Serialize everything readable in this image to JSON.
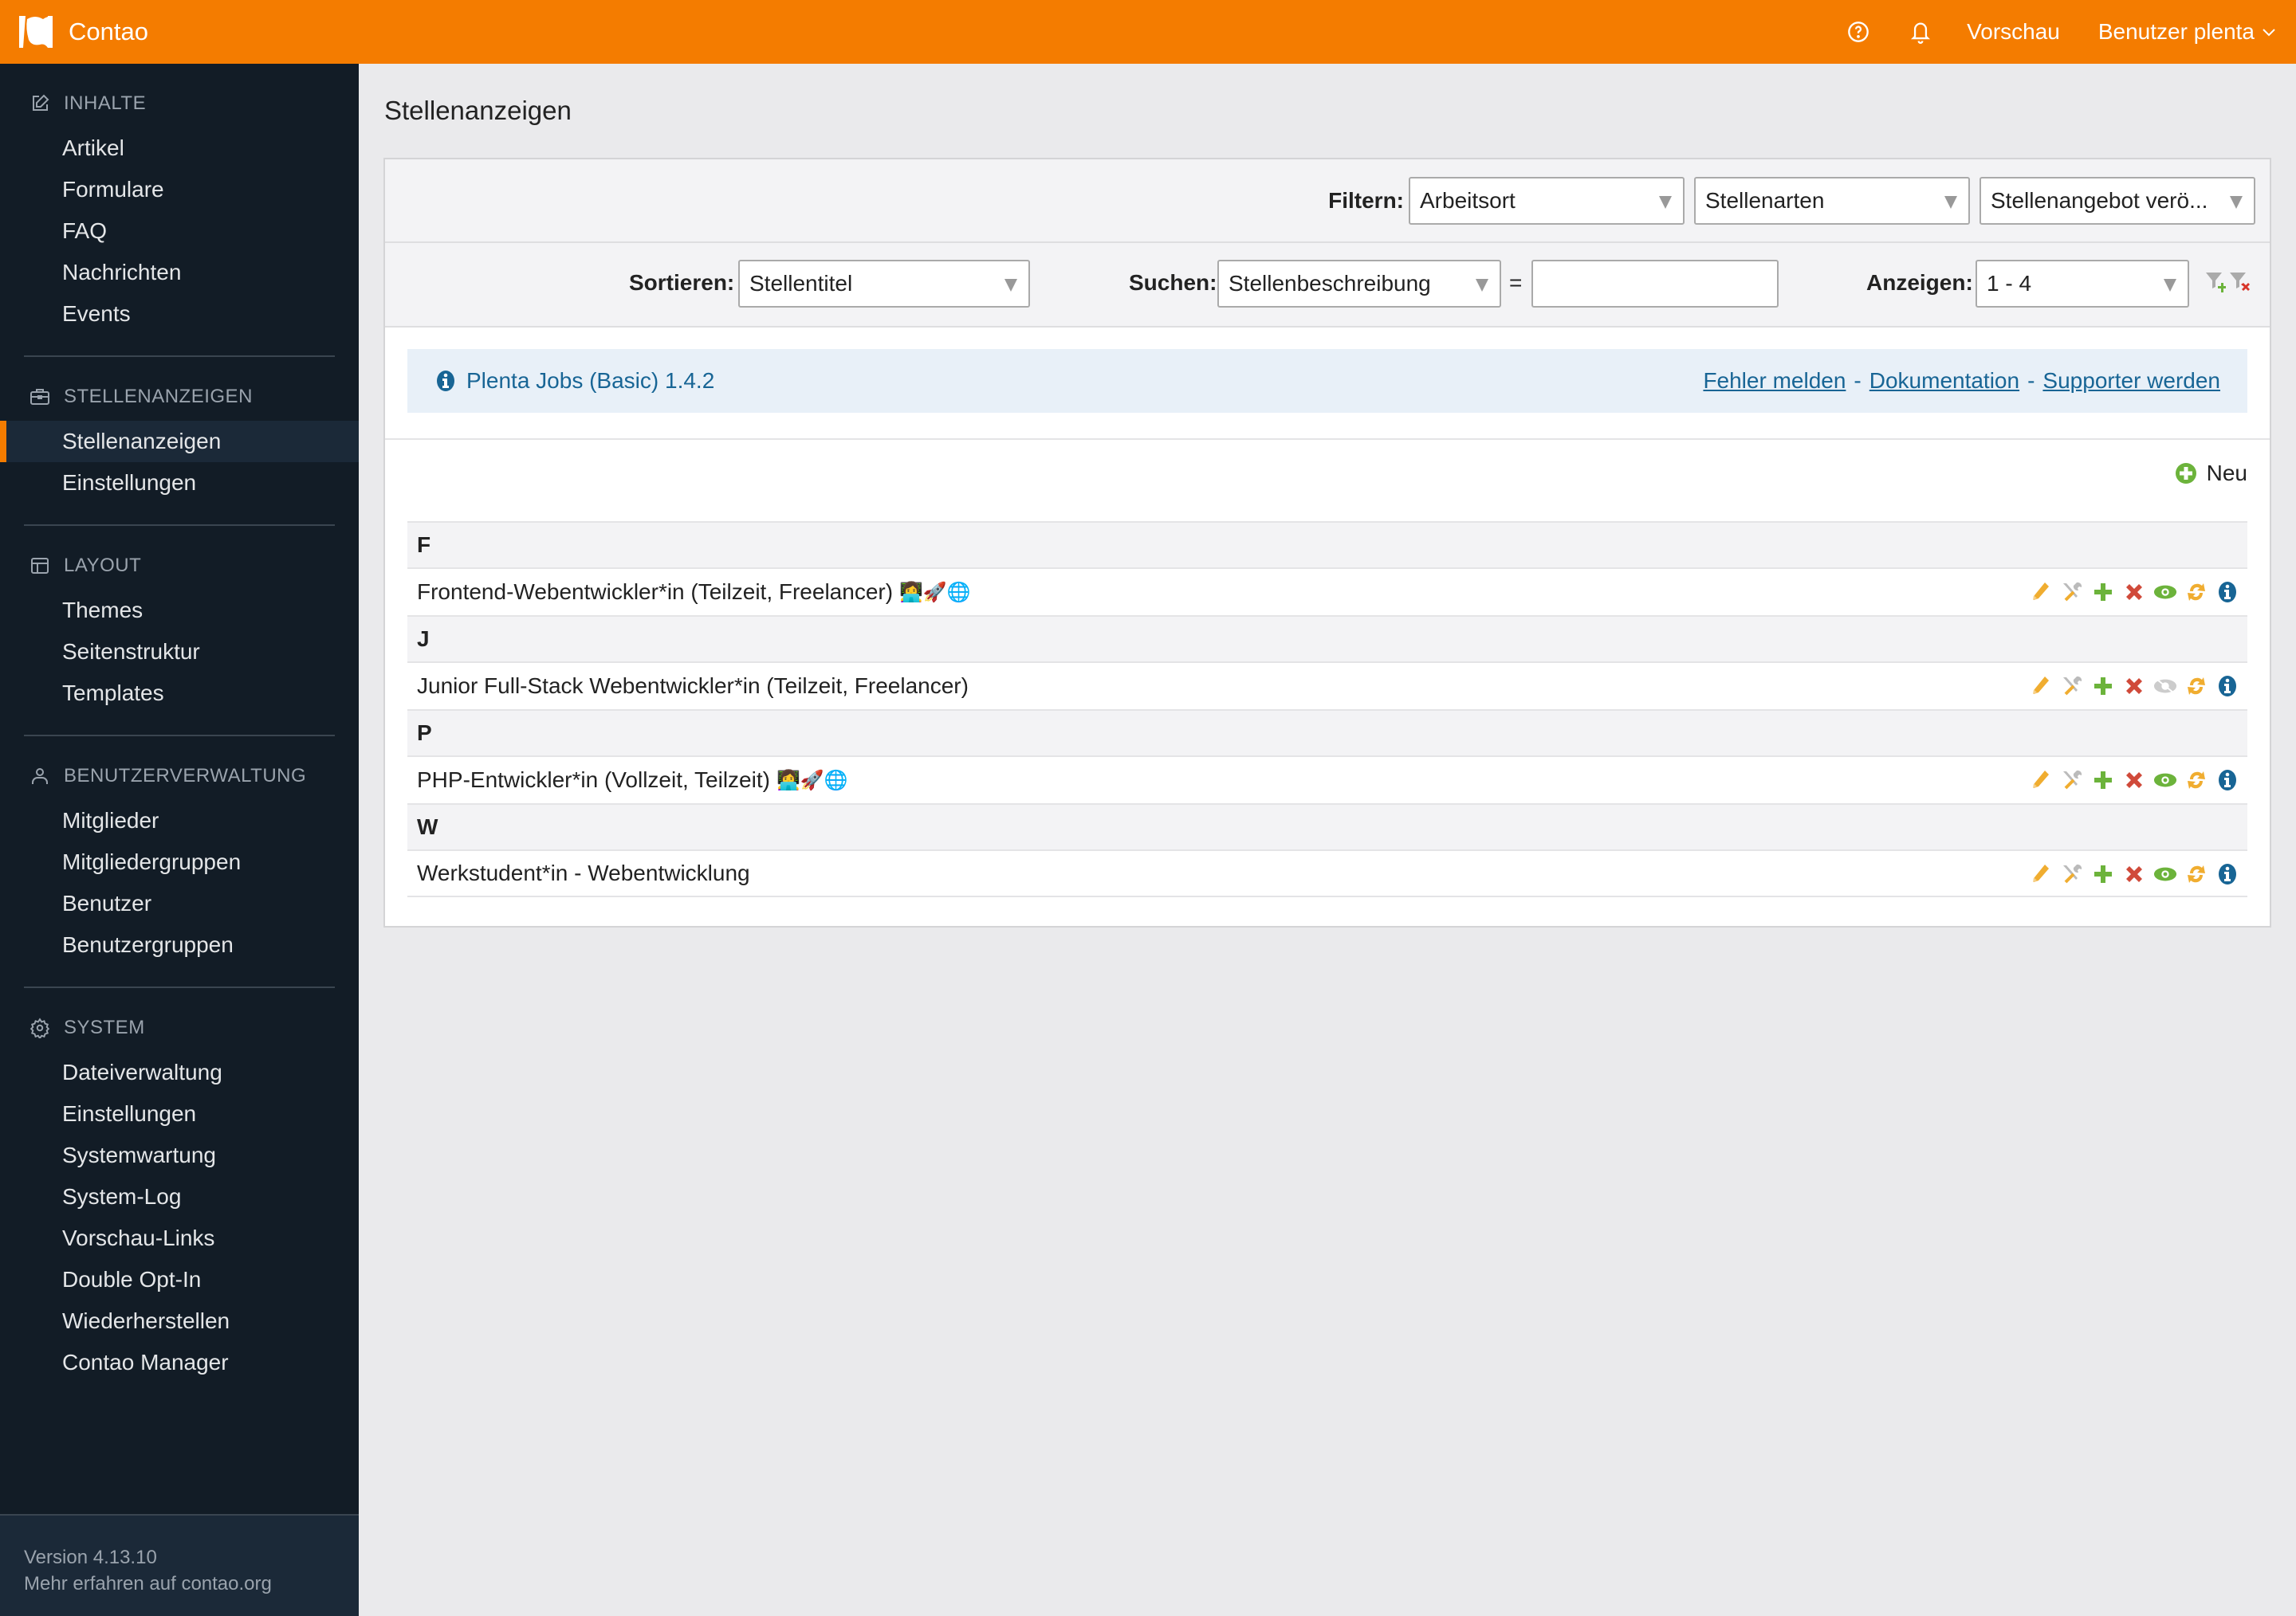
{
  "header": {
    "app_name": "Contao",
    "help_icon": "help-circle-icon",
    "notifications_icon": "bell-icon",
    "preview_label": "Vorschau",
    "user_label": "Benutzer plenta",
    "brand_color": "#f47c00"
  },
  "sidebar": {
    "groups": [
      {
        "label": "INHALTE",
        "icon": "edit-icon",
        "items": [
          "Artikel",
          "Formulare",
          "FAQ",
          "Nachrichten",
          "Events"
        ]
      },
      {
        "label": "STELLENANZEIGEN",
        "icon": "briefcase-icon",
        "items": [
          "Stellenanzeigen",
          "Einstellungen"
        ],
        "active": "Stellenanzeigen"
      },
      {
        "label": "LAYOUT",
        "icon": "layout-icon",
        "items": [
          "Themes",
          "Seitenstruktur",
          "Templates"
        ]
      },
      {
        "label": "BENUTZERVERWALTUNG",
        "icon": "user-icon",
        "items": [
          "Mitglieder",
          "Mitgliedergruppen",
          "Benutzer",
          "Benutzergruppen"
        ]
      },
      {
        "label": "SYSTEM",
        "icon": "gear-icon",
        "items": [
          "Dateiverwaltung",
          "Einstellungen",
          "Systemwartung",
          "System-Log",
          "Vorschau-Links",
          "Double Opt-In",
          "Wiederherstellen",
          "Contao Manager"
        ]
      }
    ],
    "footer": {
      "version": "Version 4.13.10",
      "learn_more": "Mehr erfahren auf contao.org"
    }
  },
  "main": {
    "page_title": "Stellenanzeigen",
    "filter": {
      "label": "Filtern:",
      "selects": [
        "Arbeitsort",
        "Stellenarten",
        "Stellenangebot verö..."
      ]
    },
    "sort": {
      "label": "Sortieren:",
      "value": "Stellentitel"
    },
    "search": {
      "label": "Suchen:",
      "field": "Stellenbeschreibung",
      "equals": "=",
      "value": ""
    },
    "limit": {
      "label": "Anzeigen:",
      "value": "1 - 4"
    },
    "info": {
      "title": "Plenta Jobs (Basic) 1.4.2",
      "links": [
        "Fehler melden",
        "Dokumentation",
        "Supporter werden"
      ],
      "separator": "-"
    },
    "new_label": "Neu",
    "groups": [
      {
        "letter": "F",
        "rows": [
          {
            "title": "Frontend-Webentwickler*in (Teilzeit, Freelancer)",
            "emoji": "👩‍💻🚀🌐",
            "published": true
          }
        ]
      },
      {
        "letter": "J",
        "rows": [
          {
            "title": "Junior Full-Stack Webentwickler*in (Teilzeit, Freelancer)",
            "emoji": "",
            "published": false
          }
        ]
      },
      {
        "letter": "P",
        "rows": [
          {
            "title": "PHP-Entwickler*in (Vollzeit, Teilzeit)",
            "emoji": "👩‍💻🚀🌐",
            "published": true
          }
        ]
      },
      {
        "letter": "W",
        "rows": [
          {
            "title": "Werkstudent*in - Webentwicklung",
            "emoji": "",
            "published": true
          }
        ]
      }
    ],
    "row_operations": [
      "edit-icon",
      "header-settings-icon",
      "copy-icon",
      "delete-icon",
      "toggle-visibility-icon",
      "move-icon",
      "info-icon"
    ]
  }
}
